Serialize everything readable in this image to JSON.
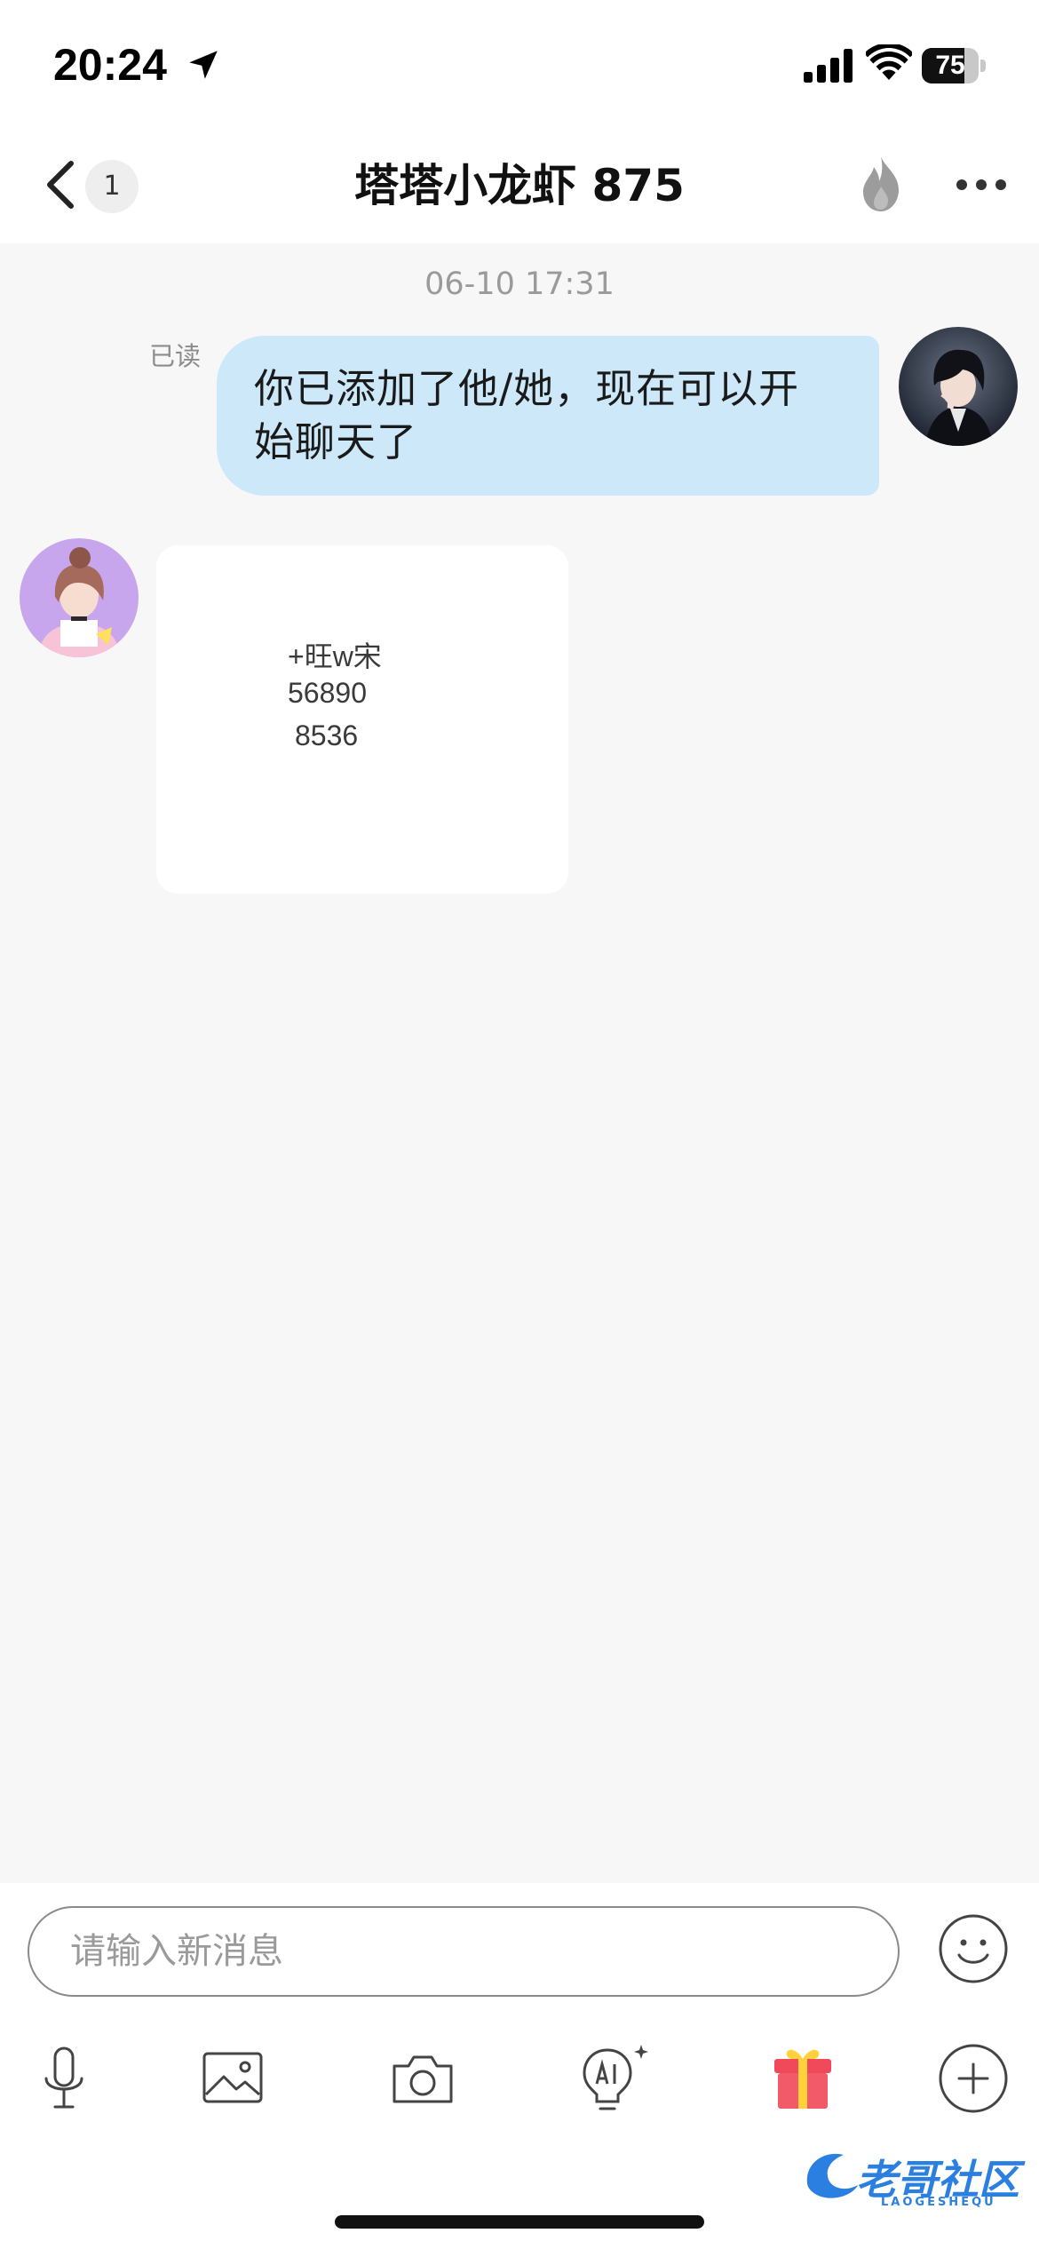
{
  "status_bar": {
    "time": "20:24",
    "battery_level": 75,
    "battery_text": "75",
    "icons": [
      "location-arrow-icon",
      "cellular-signal-icon",
      "wifi-icon",
      "battery-icon"
    ]
  },
  "nav": {
    "back_icon": "chevron-left-icon",
    "unread_count": "1",
    "title": "塔塔小龙虾 875",
    "flame_icon": "flame-icon",
    "more_icon": "more-dots-icon"
  },
  "chat": {
    "timestamp": "06-10 17:31",
    "outgoing": {
      "read_status": "已读",
      "line1": "你已添加了他/她，现在可以开",
      "line2": "始聊天了"
    },
    "incoming_image": {
      "line1": "+旺w宋",
      "line2": "56890",
      "line3": "8536"
    }
  },
  "input": {
    "placeholder": "请输入新消息"
  },
  "toolbar": {
    "icons": [
      "microphone-icon",
      "image-icon",
      "camera-icon",
      "ai-icon",
      "gift-icon",
      "plus-icon"
    ]
  },
  "watermark": {
    "text": "老哥社区",
    "subtext": "LAOGESHEQU"
  },
  "colors": {
    "outgoing_bubble": "#cde9f9",
    "background": "#f7f7f7",
    "gift_red": "#f0495a",
    "gift_yellow": "#ffd23c"
  }
}
